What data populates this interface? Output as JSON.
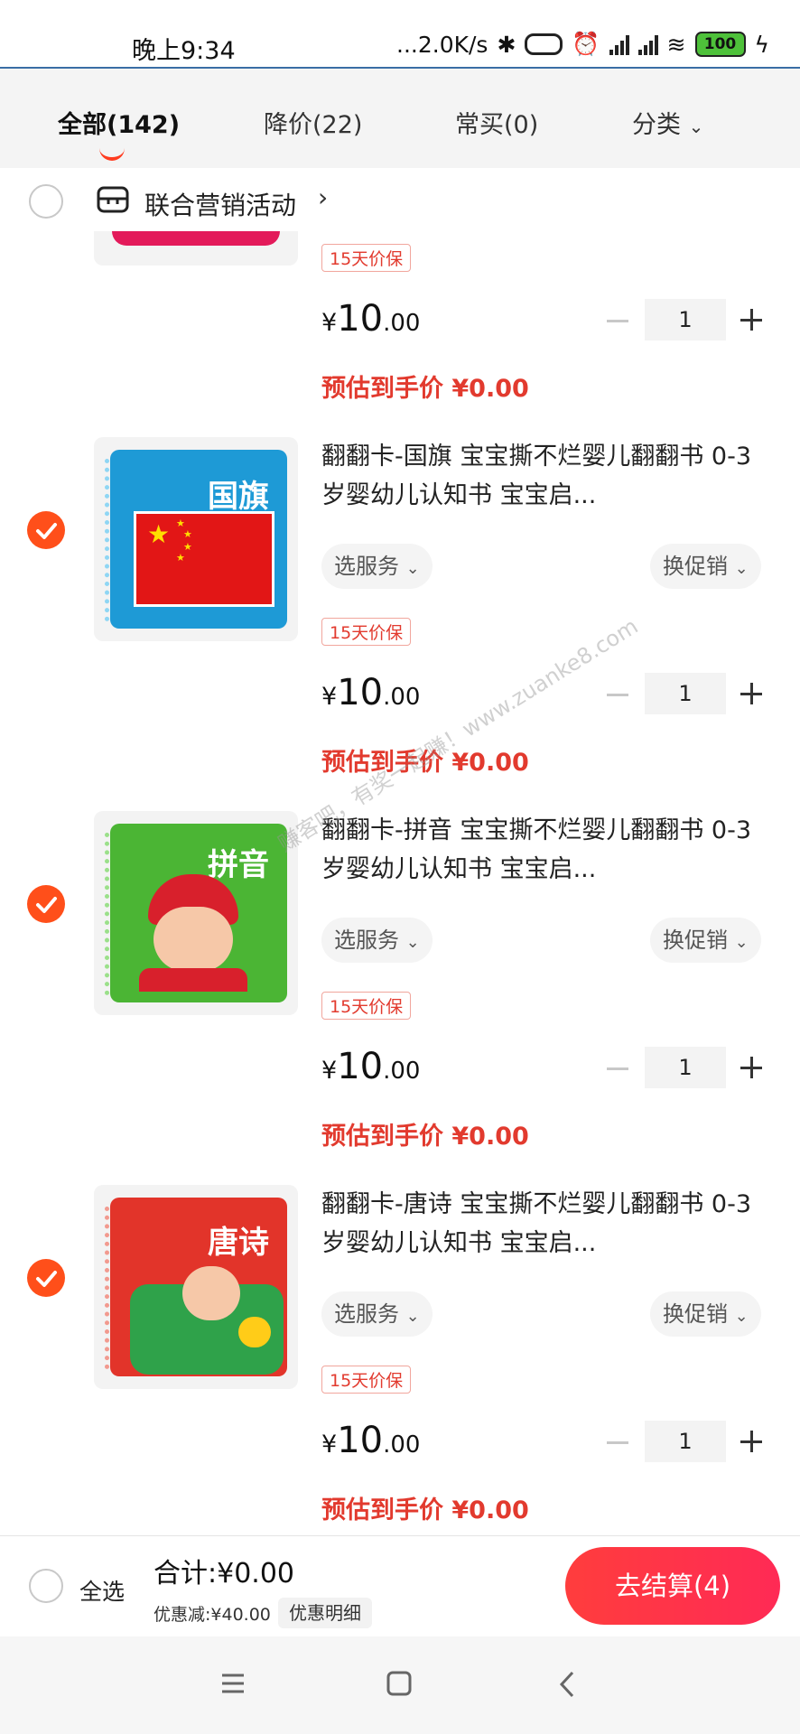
{
  "status_bar": {
    "time": "晚上9:34",
    "network_speed": "...2.0K/s",
    "battery": "100"
  },
  "tabs": [
    {
      "label": "全部(142)",
      "active": true
    },
    {
      "label": "降价(22)",
      "active": false
    },
    {
      "label": "常买(0)",
      "active": false
    },
    {
      "label": "分类",
      "active": false
    }
  ],
  "promo": {
    "label": "联合营销活动",
    "chevron": "›"
  },
  "items": [
    {
      "title": "",
      "service_label": "",
      "promo_switch_label": "",
      "price_guarantee": "15天价保",
      "price_yen": "¥",
      "price_int": "10",
      "price_dec": ".00",
      "est_price": "预估到手价 ¥0.00",
      "quantity": "1",
      "checked": false
    },
    {
      "title": "翻翻卡-国旗 宝宝撕不烂婴儿翻翻书 0-3岁婴幼儿认知书 宝宝启...",
      "cover_text": "国旗",
      "service_label": "选服务",
      "promo_switch_label": "换促销",
      "price_guarantee": "15天价保",
      "price_yen": "¥",
      "price_int": "10",
      "price_dec": ".00",
      "est_price": "预估到手价 ¥0.00",
      "quantity": "1",
      "checked": true
    },
    {
      "title": "翻翻卡-拼音 宝宝撕不烂婴儿翻翻书 0-3岁婴幼儿认知书 宝宝启...",
      "cover_text": "拼音",
      "service_label": "选服务",
      "promo_switch_label": "换促销",
      "price_guarantee": "15天价保",
      "price_yen": "¥",
      "price_int": "10",
      "price_dec": ".00",
      "est_price": "预估到手价 ¥0.00",
      "quantity": "1",
      "checked": true
    },
    {
      "title": "翻翻卡-唐诗 宝宝撕不烂婴儿翻翻书 0-3岁婴幼儿认知书 宝宝启...",
      "cover_text": "唐诗",
      "service_label": "选服务",
      "promo_switch_label": "换促销",
      "price_guarantee": "15天价保",
      "price_yen": "¥",
      "price_int": "10",
      "price_dec": ".00",
      "est_price": "预估到手价 ¥0.00",
      "quantity": "1",
      "checked": true
    }
  ],
  "bottom": {
    "select_all": "全选",
    "total": "合计:¥0.00",
    "discount": "优惠减:¥40.00",
    "discount_detail": "优惠明细",
    "checkout": "去结算(4)"
  },
  "watermark": "赚客吧，有奖一起赚！www.zuanke8.com",
  "colors": {
    "accent": "#ff4f1a",
    "price_red": "#e23a2e",
    "checkout_start": "#ff3d3d",
    "checkout_end": "#ff2a55"
  }
}
